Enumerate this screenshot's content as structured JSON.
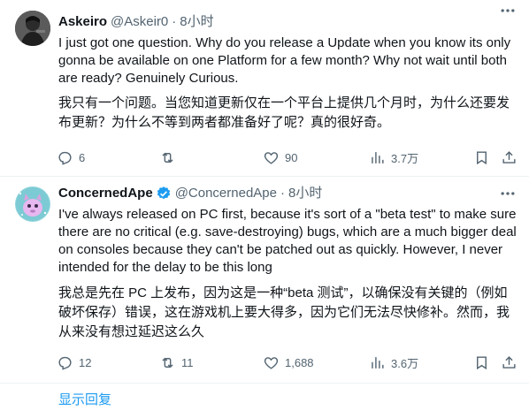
{
  "tweets": [
    {
      "display_name": "Askeiro",
      "handle": "@Askeir0",
      "separator": "·",
      "time": "8小时",
      "text_en": "I just got one question. Why do you release a Update when you know its only gonna be available on one Platform for a few month? Why not wait until both are ready? Genuinely Curious.",
      "text_zh": "我只有一个问题。当您知道更新仅在一个平台上提供几个月时，为什么还要发布更新？为什么不等到两者都准备好了呢？真的很好奇。",
      "replies": "6",
      "retweets": "",
      "likes": "90",
      "views": "3.7万"
    },
    {
      "display_name": "ConcernedApe",
      "handle": "@ConcernedApe",
      "separator": "·",
      "time": "8小时",
      "text_en": "I've always released on PC first, because it's sort of a \"beta test\" to make sure there are no critical (e.g. save-destroying) bugs, which are a much bigger deal on consoles because they can't be patched out as quickly. However, I never intended for the delay to be this long",
      "text_zh": "我总是先在 PC 上发布，因为这是一种“beta 测试”，以确保没有关键的（例如破坏保存）错误，这在游戏机上要大得多，因为它们无法尽快修补。然而，我从来没有想过延迟这么久",
      "replies": "12",
      "retweets": "11",
      "likes": "1,688",
      "views": "3.6万"
    }
  ],
  "show_replies": "显示回复",
  "icons": {
    "reply": "reply-icon",
    "retweet": "retweet-icon",
    "like": "heart-icon",
    "views": "views-icon",
    "bookmark": "bookmark-icon",
    "share": "share-icon",
    "verified": "verified-badge-icon",
    "more": "more-icon"
  },
  "colors": {
    "text": "#0f1419",
    "muted": "#536471",
    "accent": "#1d9bf0",
    "divider": "#eff3f4"
  }
}
